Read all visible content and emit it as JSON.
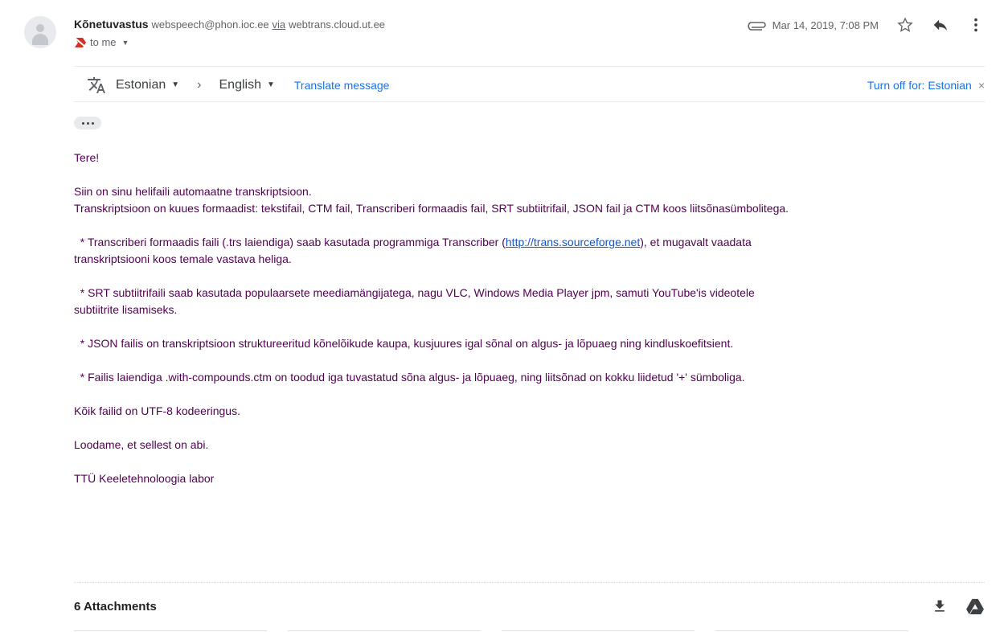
{
  "header": {
    "sender_name": "Kõnetuvastus",
    "sender_email": "webspeech@phon.ioc.ee",
    "via_label": "via",
    "via_domain": "webtrans.cloud.ut.ee",
    "to_label": "to me",
    "date": "Mar 14, 2019, 7:08 PM"
  },
  "translate_bar": {
    "source_language": "Estonian",
    "target_language": "English",
    "translate_label": "Translate message",
    "turn_off_label": "Turn off for: Estonian",
    "close_glyph": "×"
  },
  "body": {
    "greeting": "Tere!",
    "line1": "Siin on sinu helifaili automaatne transkriptsioon.",
    "line2": "Transkriptsioon on kuues formaadist: tekstifail, CTM fail, Transcriberi formaadis fail, SRT subtiitrifail, JSON fail ja CTM koos liitsõnasümbolitega.",
    "bullet1_before": "  * Transcriberi formaadis faili (.trs laiendiga) saab kasutada programmiga Transcriber (",
    "bullet1_link": "http://trans.sourceforge.net",
    "bullet1_after": "), et mugavalt vaadata",
    "bullet1_cont": "transkriptsiooni koos temale vastava heliga.",
    "bullet2": "  * SRT subtiitrifaili saab kasutada populaarsete meediamängijatega, nagu VLC, Windows Media Player jpm, samuti YouTube'is videotele",
    "bullet2_cont": "subtiitrite lisamiseks.",
    "bullet3": "  * JSON failis on transkriptsioon struktureeritud kõnelõikude kaupa, kusjuures igal sõnal on algus- ja lõpuaeg ning kindluskoefitsient.",
    "bullet4": "  * Failis laiendiga .with-compounds.ctm on toodud iga tuvastatud sõna algus- ja lõpuaeg, ning liitsõnad on kokku liidetud '+' sümboliga.",
    "encoding": "Kõik failid on UTF-8 kodeeringus.",
    "closing": "Loodame, et sellest on abi.",
    "signature": "TTÜ Keeletehnoloogia labor"
  },
  "attachments": {
    "label": "6 Attachments"
  },
  "icons": {
    "avatar": "avatar-icon",
    "importance": "importance-marker-icon",
    "attachment": "paperclip-icon",
    "star": "star-icon",
    "reply": "reply-icon",
    "more": "more-vert-icon",
    "translate": "translate-icon",
    "download": "download-icon",
    "drive": "drive-icon"
  },
  "colors": {
    "accent": "#1a73e8",
    "body_text": "#500050",
    "link": "#1155cc",
    "importance": "#d93025"
  }
}
